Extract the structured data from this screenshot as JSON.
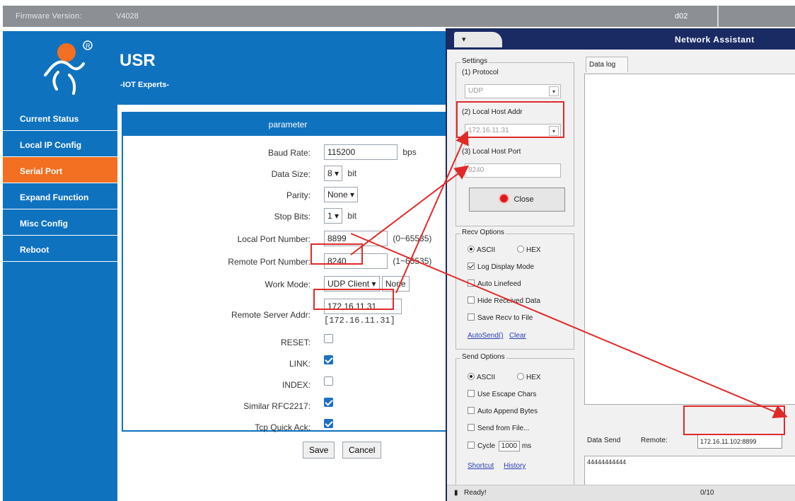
{
  "topbar": {
    "firmware_label": "Firmware Version:",
    "firmware_value": "V4028",
    "right_text": "d02"
  },
  "header": {
    "brand": "USR",
    "tagline": "-IOT Experts-"
  },
  "sidebar": {
    "items": [
      {
        "label": "Current Status"
      },
      {
        "label": "Local IP Config"
      },
      {
        "label": "Serial Port",
        "active": true
      },
      {
        "label": "Expand Function"
      },
      {
        "label": "Misc Config"
      },
      {
        "label": "Reboot"
      }
    ]
  },
  "params": {
    "heading": "parameter",
    "baud_label": "Baud Rate:",
    "baud_value": "115200",
    "baud_unit": "bps",
    "datasize_label": "Data Size:",
    "datasize_value": "8",
    "datasize_unit": "bit",
    "parity_label": "Parity:",
    "parity_value": "None",
    "stopbits_label": "Stop Bits:",
    "stopbits_value": "1",
    "stopbits_unit": "bit",
    "localport_label": "Local Port Number:",
    "localport_value": "8899",
    "localport_range": "(0~65535)",
    "remoteport_label": "Remote Port Number:",
    "remoteport_value": "8240",
    "remoteport_range": "(1~65535)",
    "workmode_label": "Work Mode:",
    "workmode_value": "UDP Client",
    "workmode_extra": "None",
    "remoteaddr_label": "Remote Server Addr:",
    "remoteaddr_value": "172.16.11.31",
    "remoteaddr_resolved": "[172.16.11.31]",
    "reset_label": "RESET:",
    "reset_checked": false,
    "link_label": "LINK:",
    "link_checked": true,
    "index_label": "INDEX:",
    "index_checked": false,
    "rfc_label": "Similar RFC2217:",
    "rfc_checked": true,
    "tcpack_label": "Tcp Quick Ack:",
    "tcpack_checked": true,
    "save_label": "Save",
    "cancel_label": "Cancel"
  },
  "assistant": {
    "tab_label": " ▾",
    "title": "Network Assistant",
    "settings": {
      "title": "Settings",
      "protocol_label": "(1) Protocol",
      "protocol_value": "UDP",
      "host_addr_label": "(2) Local Host Addr",
      "host_addr_value": "172.16.11.31",
      "host_port_label": "(3) Local Host Port",
      "host_port_value": "8240",
      "close_label": "Close"
    },
    "recv": {
      "title": "Recv Options",
      "ascii": "ASCII",
      "hex": "HEX",
      "log_display": "Log Display Mode",
      "auto_linefeed": "Auto Linefeed",
      "hide_received": "Hide Received Data",
      "save_recv": "Save Recv to File",
      "autosend_link": "AutoSend()",
      "clear_link": "Clear"
    },
    "send": {
      "title": "Send Options",
      "ascii": "ASCII",
      "hex": "HEX",
      "escape": "Use Escape Chars",
      "append": "Auto Append Bytes",
      "from_file": "Send from File...",
      "cycle": "Cycle",
      "cycle_value": "1000",
      "cycle_unit": "ms",
      "shortcut_link": "Shortcut",
      "history_link": "History"
    },
    "datalog_label": "Data log",
    "data_send_label": "Data Send",
    "remote_label": "Remote:",
    "remote_value": "172.16.11.102:8899",
    "send_text": "44444444444",
    "status_ready": "Ready!",
    "status_count": "0/10"
  },
  "colors": {
    "brand_blue": "#0f72bf",
    "active_orange": "#f36f21",
    "annotation_red": "#e02a2a",
    "assistant_title": "#1a2a63"
  }
}
